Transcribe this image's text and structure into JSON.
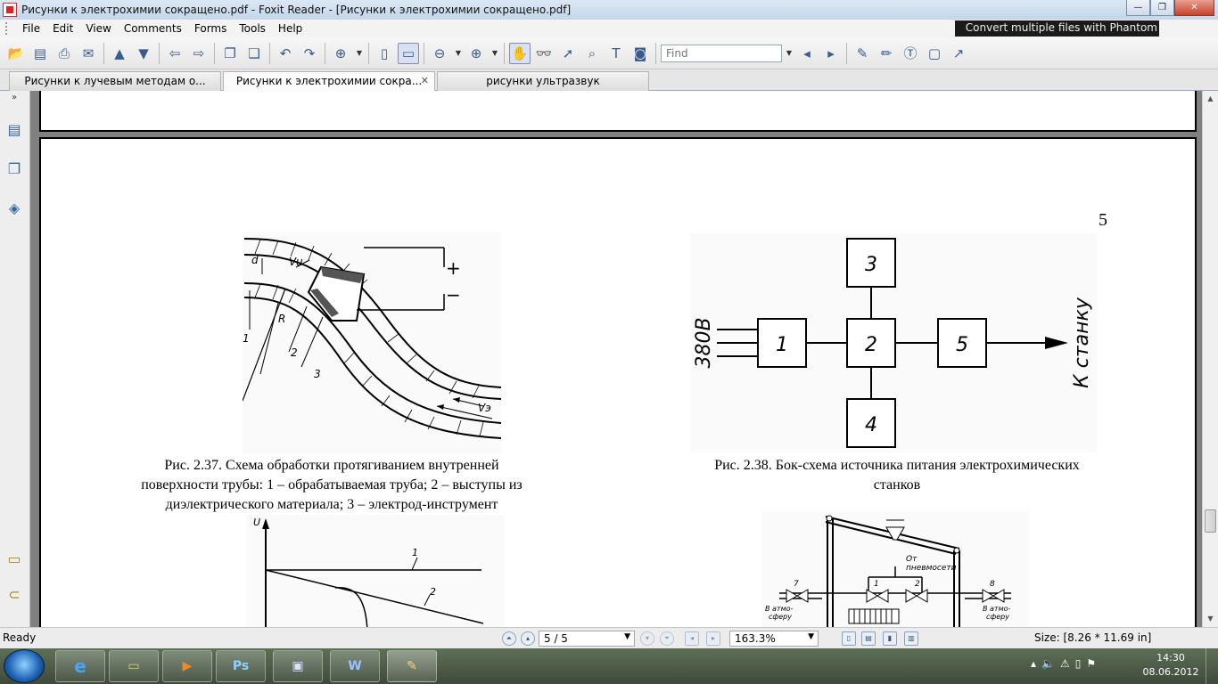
{
  "window": {
    "title": "Рисунки к электрохимии сокращено.pdf - Foxit Reader - [Рисунки к электрохимии сокращено.pdf]",
    "minimize_symbol": "—",
    "maximize_symbol": "❐",
    "close_symbol": "✕"
  },
  "menu": {
    "items": [
      "File",
      "Edit",
      "View",
      "Comments",
      "Forms",
      "Tools",
      "Help"
    ],
    "ad_text": "Convert multiple files with Phantom"
  },
  "toolbar": {
    "find_placeholder": "Find"
  },
  "tabs": [
    {
      "label": "Рисунки к лучевым методам о..."
    },
    {
      "label": "Рисунки к электрохимии сокра..."
    },
    {
      "label": "рисунки ультразвук"
    }
  ],
  "page": {
    "number": "5",
    "fig237": {
      "labels": {
        "plus": "+",
        "minus": "−",
        "d": "d",
        "vu": "Vu",
        "r": "R",
        "n1": "1",
        "n2": "2",
        "n3": "3",
        "ve": "Vэ"
      },
      "caption": [
        "Рис. 2.37. Схема обработки протягиванием внутренней",
        "поверхности трубы:  1 – обрабатываемая труба; 2 – выступы из",
        "диэлектрического материала; 3 – электрод-инструмент"
      ]
    },
    "fig238": {
      "blocks": [
        "1",
        "2",
        "3",
        "4",
        "5"
      ],
      "input_label": "380В",
      "output_label": "К станку",
      "caption": [
        "Рис. 2.38. Бок-схема источника питания электрохимических",
        "станков"
      ]
    },
    "fig_graph": {
      "axis_label": "U",
      "curve_labels": [
        "1",
        "2"
      ]
    },
    "fig_pneumatic": {
      "labels": {
        "from_net": "От",
        "from_net2": "пневмосети",
        "v1": "1",
        "v2": "2",
        "v7": "7",
        "v8": "8",
        "atm1a": "В  атмо-",
        "atm1b": "сферу",
        "atm2a": "В  атмо-",
        "atm2b": "сферу"
      }
    }
  },
  "status": {
    "ready": "Ready",
    "page_field": "5 / 5",
    "zoom": "163.3%",
    "size": "Size: [8.26 * 11.69 in]"
  },
  "taskbar": {
    "ps_label": "Ps",
    "word_label": "W",
    "time": "14:30",
    "date": "08.06.2012"
  }
}
